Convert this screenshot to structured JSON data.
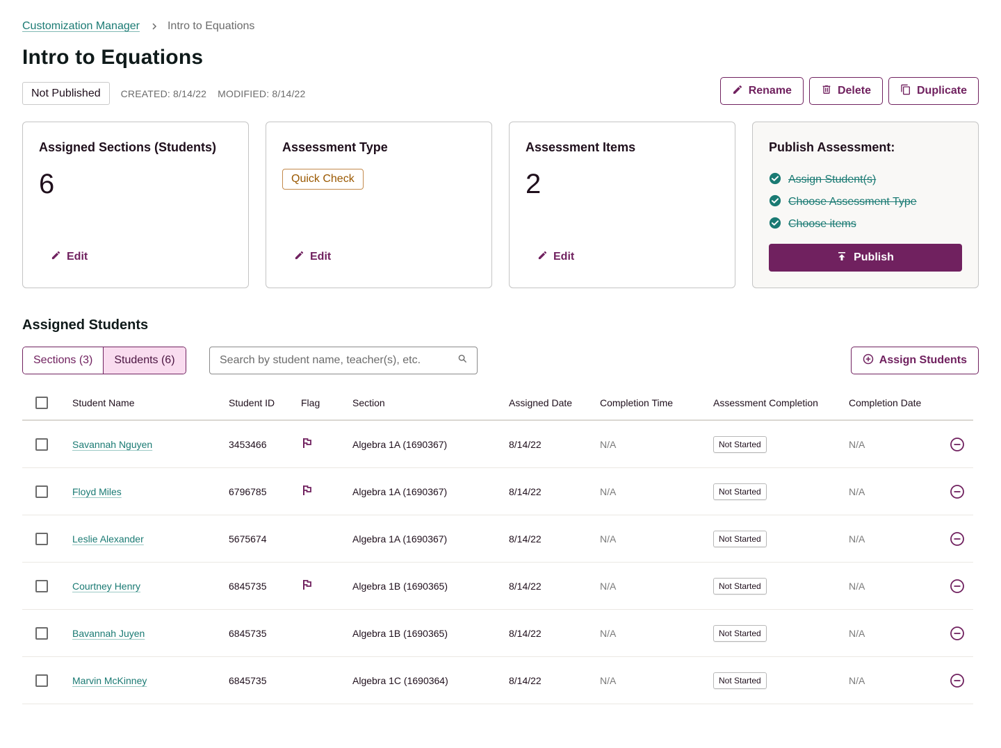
{
  "breadcrumb": {
    "parent": "Customization Manager",
    "separator_icon": "chevron-right-icon",
    "current": "Intro to Equations"
  },
  "page": {
    "title": "Intro to Equations",
    "status": "Not Published",
    "created": "CREATED: 8/14/22",
    "modified": "MODIFIED: 8/14/22"
  },
  "actions": {
    "rename": "Rename",
    "delete": "Delete",
    "duplicate": "Duplicate"
  },
  "cards": {
    "sections": {
      "title": "Assigned Sections (Students)",
      "value": "6",
      "edit": "Edit"
    },
    "type": {
      "title": "Assessment Type",
      "badge": "Quick Check",
      "edit": "Edit"
    },
    "items": {
      "title": "Assessment Items",
      "value": "2",
      "edit": "Edit"
    },
    "publish": {
      "title": "Publish Assessment:",
      "checklist": [
        "Assign Student(s)",
        "Choose Assessment Type",
        "Choose items"
      ],
      "button": "Publish"
    }
  },
  "students_section": {
    "title": "Assigned Students",
    "tabs": [
      {
        "label": "Sections (3)",
        "active": false
      },
      {
        "label": "Students (6)",
        "active": true
      }
    ],
    "search_placeholder": "Search by student name, teacher(s), etc.",
    "assign_button": "Assign Students"
  },
  "table": {
    "columns": [
      "Student Name",
      "Student ID",
      "Flag",
      "Section",
      "Assigned Date",
      "Completion Time",
      "Assessment Completion",
      "Completion Date"
    ],
    "rows": [
      {
        "name": "Savannah Nguyen",
        "id": "3453466",
        "flagged": true,
        "section": "Algebra 1A (1690367)",
        "assigned": "8/14/22",
        "time": "N/A",
        "completion": "Not Started",
        "completion_date": "N/A"
      },
      {
        "name": "Floyd Miles",
        "id": "6796785",
        "flagged": true,
        "section": "Algebra 1A (1690367)",
        "assigned": "8/14/22",
        "time": "N/A",
        "completion": "Not Started",
        "completion_date": "N/A"
      },
      {
        "name": "Leslie Alexander",
        "id": "5675674",
        "flagged": false,
        "section": "Algebra 1A (1690367)",
        "assigned": "8/14/22",
        "time": "N/A",
        "completion": "Not Started",
        "completion_date": "N/A"
      },
      {
        "name": "Courtney Henry",
        "id": "6845735",
        "flagged": true,
        "section": "Algebra 1B (1690365)",
        "assigned": "8/14/22",
        "time": "N/A",
        "completion": "Not Started",
        "completion_date": "N/A"
      },
      {
        "name": "Bavannah Juyen",
        "id": "6845735",
        "flagged": false,
        "section": "Algebra 1B (1690365)",
        "assigned": "8/14/22",
        "time": "N/A",
        "completion": "Not Started",
        "completion_date": "N/A"
      },
      {
        "name": "Marvin McKinney",
        "id": "6845735",
        "flagged": false,
        "section": "Algebra 1C (1690364)",
        "assigned": "8/14/22",
        "time": "N/A",
        "completion": "Not Started",
        "completion_date": "N/A"
      }
    ]
  },
  "colors": {
    "brand": "#70215f",
    "link": "#1a7a73",
    "badge_warning": "#9a5800",
    "active_tab_bg": "#f9dcef"
  }
}
